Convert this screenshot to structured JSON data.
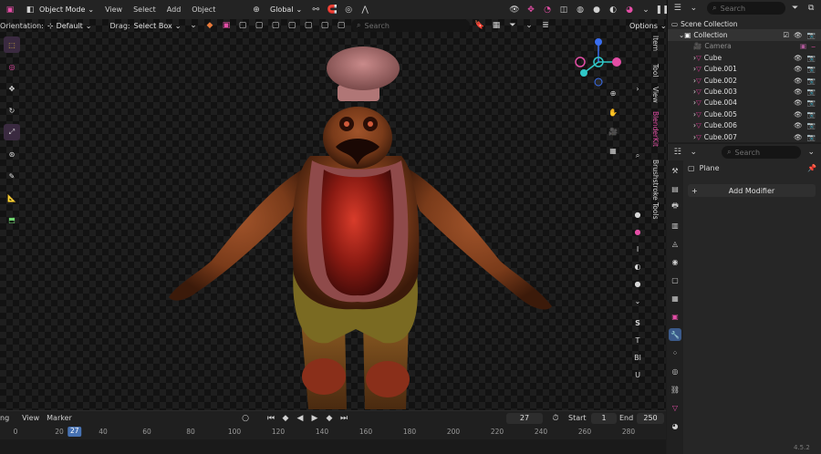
{
  "header": {
    "mode": "Object Mode",
    "menus": [
      "View",
      "Select",
      "Add",
      "Object"
    ],
    "transform": "Global",
    "search_placeholder": "Search",
    "options": "Options"
  },
  "toolrow": {
    "orientation_label": "Orientation:",
    "orientation_value": "Default",
    "drag_label": "Drag:",
    "drag_value": "Select Box"
  },
  "viewport_tabs": [
    "Item",
    "Tool",
    "View",
    "BlenderKit",
    "Brushstroke Tools"
  ],
  "side_labels": [
    "I",
    "S",
    "T",
    "Bl",
    "U"
  ],
  "outliner": {
    "title": "Scene Collection",
    "search_placeholder": "Search",
    "collection": "Collection",
    "items": [
      "Camera",
      "Cube",
      "Cube.001",
      "Cube.002",
      "Cube.003",
      "Cube.004",
      "Cube.005",
      "Cube.006",
      "Cube.007"
    ]
  },
  "properties": {
    "search_placeholder": "Search",
    "object_name": "Plane",
    "add_modifier": "Add Modifier"
  },
  "timeline": {
    "menus": [
      "ng",
      "View",
      "Marker"
    ],
    "current_frame": "27",
    "start_label": "Start",
    "start": "1",
    "end_label": "End",
    "end": "250",
    "ticks": [
      "0",
      "20",
      "40",
      "60",
      "80",
      "100",
      "120",
      "140",
      "160",
      "180",
      "200",
      "220",
      "240",
      "260",
      "280"
    ]
  },
  "version": "4.5.2",
  "colors": {
    "accent": "#e44ea6",
    "highlight": "#4772b3",
    "bg": "#1d1d1d"
  }
}
